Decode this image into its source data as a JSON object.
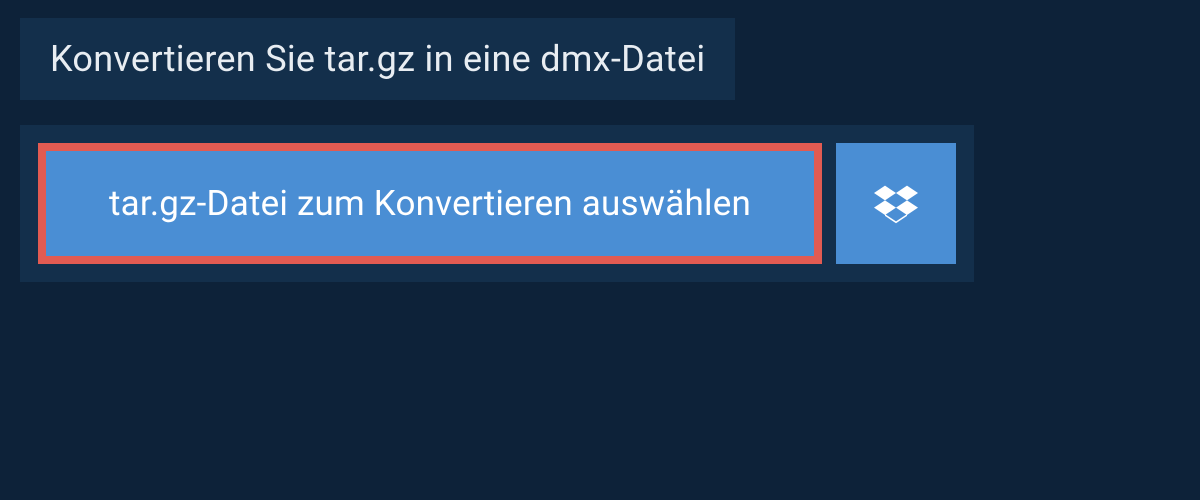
{
  "header": {
    "title": "Konvertieren Sie tar.gz in eine dmx-Datei"
  },
  "upload": {
    "select_file_label": "tar.gz-Datei zum Konvertieren auswählen"
  },
  "colors": {
    "background": "#0d2239",
    "panel": "#132f4b",
    "button": "#4a8ed4",
    "button_border": "#e25b52",
    "text_light": "#e8edf2",
    "text_white": "#ffffff"
  }
}
